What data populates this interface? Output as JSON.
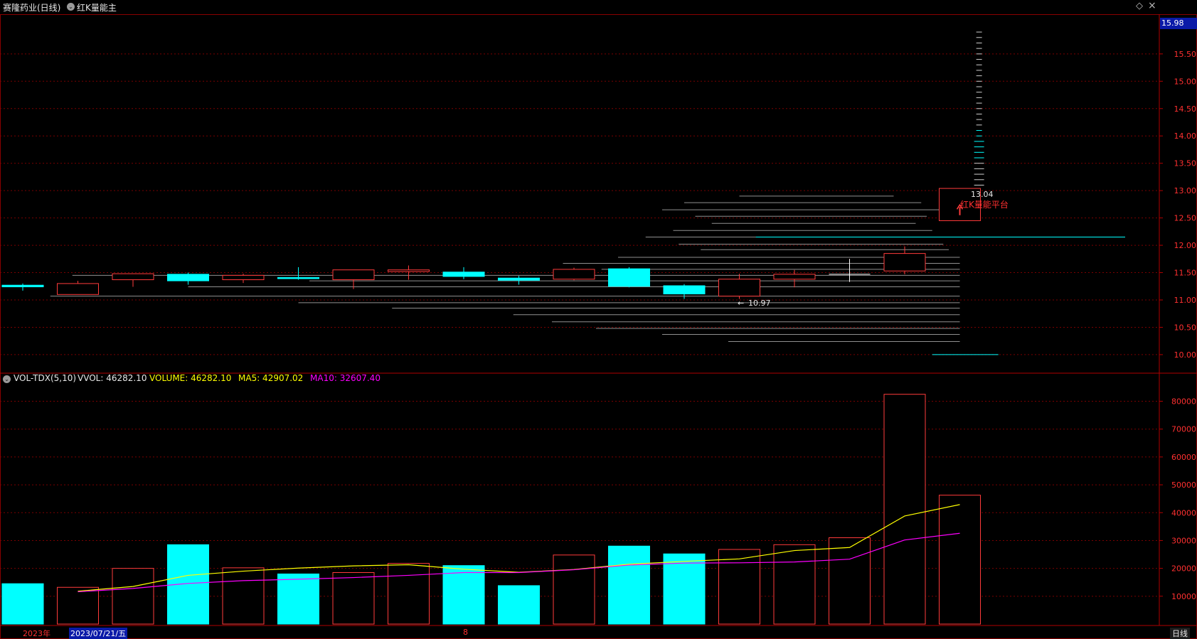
{
  "window": {
    "title": "赛隆药业(日线)",
    "indicator_name": "红K量能主",
    "expand_glyph": "⌄",
    "diamond_glyph": "◇",
    "close_glyph": "×",
    "icons": [
      "chevron-down-icon",
      "diamond-icon",
      "close-icon"
    ]
  },
  "price_panel": {
    "current_price_label": "15.98",
    "high_annotation": "13.04",
    "low_annotation": "10.97",
    "signal_text": "红K量能平台",
    "arrow_glyph": "←"
  },
  "volume_panel": {
    "indicator": "VOL-TDX(5,10)",
    "vvol": "VVOL: 46282.10",
    "volume": "VOLUME: 46282.10",
    "ma5": "MA5: 42907.02",
    "ma10": "MA10: 32607.40"
  },
  "bottom_bar": {
    "year_label": "2023年",
    "date_label": "2023/07/21/五",
    "month_label": "8",
    "period_label": "日线"
  },
  "colors": {
    "up": "#ff3b3b",
    "down": "#00ffff",
    "ma5": "#ffff00",
    "ma10": "#ff00ff",
    "grid": "#7a0000",
    "axis_text": "#ff3030",
    "profile": "#8f8f8f"
  },
  "chart_data": [
    {
      "type": "candlestick",
      "title": "",
      "ylim": [
        9.7,
        16.2
      ],
      "y_ticks": [
        10.0,
        10.5,
        11.0,
        11.5,
        12.0,
        12.5,
        13.0,
        13.5,
        14.0,
        14.5,
        15.0,
        15.5
      ],
      "tick_labels": [
        "10.00",
        "10.50",
        "11.00",
        "11.50",
        "12.00",
        "12.50",
        "13.00",
        "13.50",
        "14.00",
        "14.50",
        "15.00",
        "15.50"
      ],
      "candles": [
        {
          "o": 11.27,
          "c": 11.24,
          "h": 11.3,
          "l": 11.17
        },
        {
          "o": 11.1,
          "c": 11.3,
          "h": 11.35,
          "l": 11.1
        },
        {
          "o": 11.37,
          "c": 11.48,
          "h": 11.48,
          "l": 11.24
        },
        {
          "o": 11.47,
          "c": 11.35,
          "h": 11.5,
          "l": 11.28
        },
        {
          "o": 11.37,
          "c": 11.45,
          "h": 11.48,
          "l": 11.31
        },
        {
          "o": 11.41,
          "c": 11.39,
          "h": 11.6,
          "l": 11.37
        },
        {
          "o": 11.37,
          "c": 11.55,
          "h": 11.55,
          "l": 11.2
        },
        {
          "o": 11.52,
          "c": 11.55,
          "h": 11.63,
          "l": 11.37
        },
        {
          "o": 11.51,
          "c": 11.43,
          "h": 11.6,
          "l": 11.38
        },
        {
          "o": 11.4,
          "c": 11.36,
          "h": 11.44,
          "l": 11.28
        },
        {
          "o": 11.38,
          "c": 11.56,
          "h": 11.59,
          "l": 11.36
        },
        {
          "o": 11.57,
          "c": 11.25,
          "h": 11.6,
          "l": 11.23
        },
        {
          "o": 11.26,
          "c": 11.11,
          "h": 11.29,
          "l": 11.02
        },
        {
          "o": 11.07,
          "c": 11.38,
          "h": 11.48,
          "l": 11.02
        },
        {
          "o": 11.38,
          "c": 11.47,
          "h": 11.55,
          "l": 11.23
        },
        {
          "o": 11.47,
          "c": 11.47,
          "h": 11.75,
          "l": 11.33
        },
        {
          "o": 11.53,
          "c": 11.85,
          "h": 11.98,
          "l": 11.47
        },
        {
          "o": 12.45,
          "c": 13.04,
          "h": 13.04,
          "l": 12.45
        }
      ],
      "profile_lines": [
        {
          "price": 12.9,
          "from": 13,
          "to": 15.8
        },
        {
          "price": 12.78,
          "from": 12,
          "to": 16.3
        },
        {
          "price": 12.65,
          "from": 11.6,
          "to": 16.95
        },
        {
          "price": 12.53,
          "from": 12.2,
          "to": 16.4
        },
        {
          "price": 12.4,
          "from": 12.5,
          "to": 16.2
        },
        {
          "price": 12.27,
          "from": 11.8,
          "to": 16.5
        },
        {
          "price": 12.15,
          "from": 11.3,
          "to": 17.0
        },
        {
          "price": 12.02,
          "from": 11.9,
          "to": 16.7
        },
        {
          "price": 11.92,
          "from": 12.3,
          "to": 16.8
        },
        {
          "price": 11.78,
          "from": 10.8,
          "to": 17.0
        },
        {
          "price": 11.67,
          "from": 9.8,
          "to": 17.0
        },
        {
          "price": 11.56,
          "from": 10.5,
          "to": 17.0
        },
        {
          "price": 11.45,
          "from": 0.9,
          "to": 17.0
        },
        {
          "price": 11.35,
          "from": 5.2,
          "to": 17.0
        },
        {
          "price": 11.24,
          "from": 3.0,
          "to": 17.0
        },
        {
          "price": 11.07,
          "from": 0.5,
          "to": 17.0
        },
        {
          "price": 10.95,
          "from": 5.0,
          "to": 17.0
        },
        {
          "price": 10.85,
          "from": 6.7,
          "to": 17.0
        },
        {
          "price": 10.73,
          "from": 8.9,
          "to": 17.0
        },
        {
          "price": 10.6,
          "from": 9.6,
          "to": 17.0
        },
        {
          "price": 10.48,
          "from": 10.4,
          "to": 17.0
        },
        {
          "price": 10.37,
          "from": 11.6,
          "to": 17.0
        },
        {
          "price": 10.24,
          "from": 12.8,
          "to": 17.0
        }
      ],
      "cyan_lines": [
        {
          "price": 12.15,
          "from": 13.3,
          "to": 20.0
        },
        {
          "price": 10.0,
          "from": 16.5,
          "to": 17.7
        }
      ],
      "tick_ladder": {
        "x_index": 17.35,
        "from": 13.1,
        "to": 15.98
      }
    },
    {
      "type": "bar",
      "title": "",
      "ylim": [
        0,
        86000
      ],
      "y_ticks": [
        10000,
        20000,
        30000,
        40000,
        50000,
        60000,
        70000,
        80000
      ],
      "tick_labels": [
        "10000",
        "20000",
        "30000",
        "40000",
        "50000",
        "60000",
        "70000",
        "80000"
      ],
      "values": [
        14500,
        13200,
        20000,
        28500,
        20200,
        18000,
        18500,
        21800,
        21000,
        13800,
        24800,
        28000,
        25200,
        26800,
        28500,
        31000,
        82500,
        46282.1
      ],
      "up": [
        false,
        true,
        true,
        false,
        true,
        false,
        true,
        true,
        false,
        false,
        true,
        false,
        false,
        true,
        true,
        true,
        true,
        true
      ],
      "series": [
        {
          "name": "MA5",
          "values": [
            null,
            11800,
            13500,
            17500,
            19000,
            20100,
            20900,
            21300,
            19700,
            18600,
            19600,
            21500,
            22500,
            23400,
            26400,
            27500,
            38800,
            42907.02
          ]
        },
        {
          "name": "MA10",
          "values": [
            null,
            11600,
            12800,
            14600,
            15600,
            16100,
            16700,
            17500,
            18500,
            18500,
            19500,
            21200,
            21900,
            22000,
            22300,
            23300,
            30200,
            32607.4
          ]
        }
      ]
    }
  ]
}
